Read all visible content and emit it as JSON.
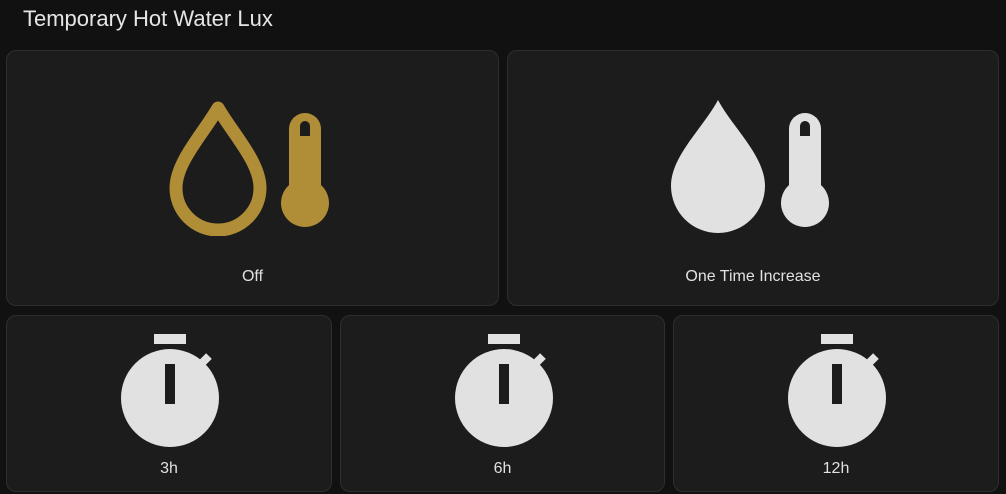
{
  "header": {
    "title": "Temporary Hot Water Lux"
  },
  "colors": {
    "active": "#b08d37",
    "inactive": "#e1e1e1",
    "card_bg": "#1c1c1c",
    "page_bg": "#111111"
  },
  "modes": [
    {
      "label": "Off",
      "icon": "water-thermometer-outline-icon",
      "state": "active"
    },
    {
      "label": "One Time Increase",
      "icon": "water-thermometer-icon",
      "state": "inactive"
    }
  ],
  "timers": [
    {
      "label": "3h",
      "icon": "timer-icon"
    },
    {
      "label": "6h",
      "icon": "timer-icon"
    },
    {
      "label": "12h",
      "icon": "timer-icon"
    }
  ]
}
